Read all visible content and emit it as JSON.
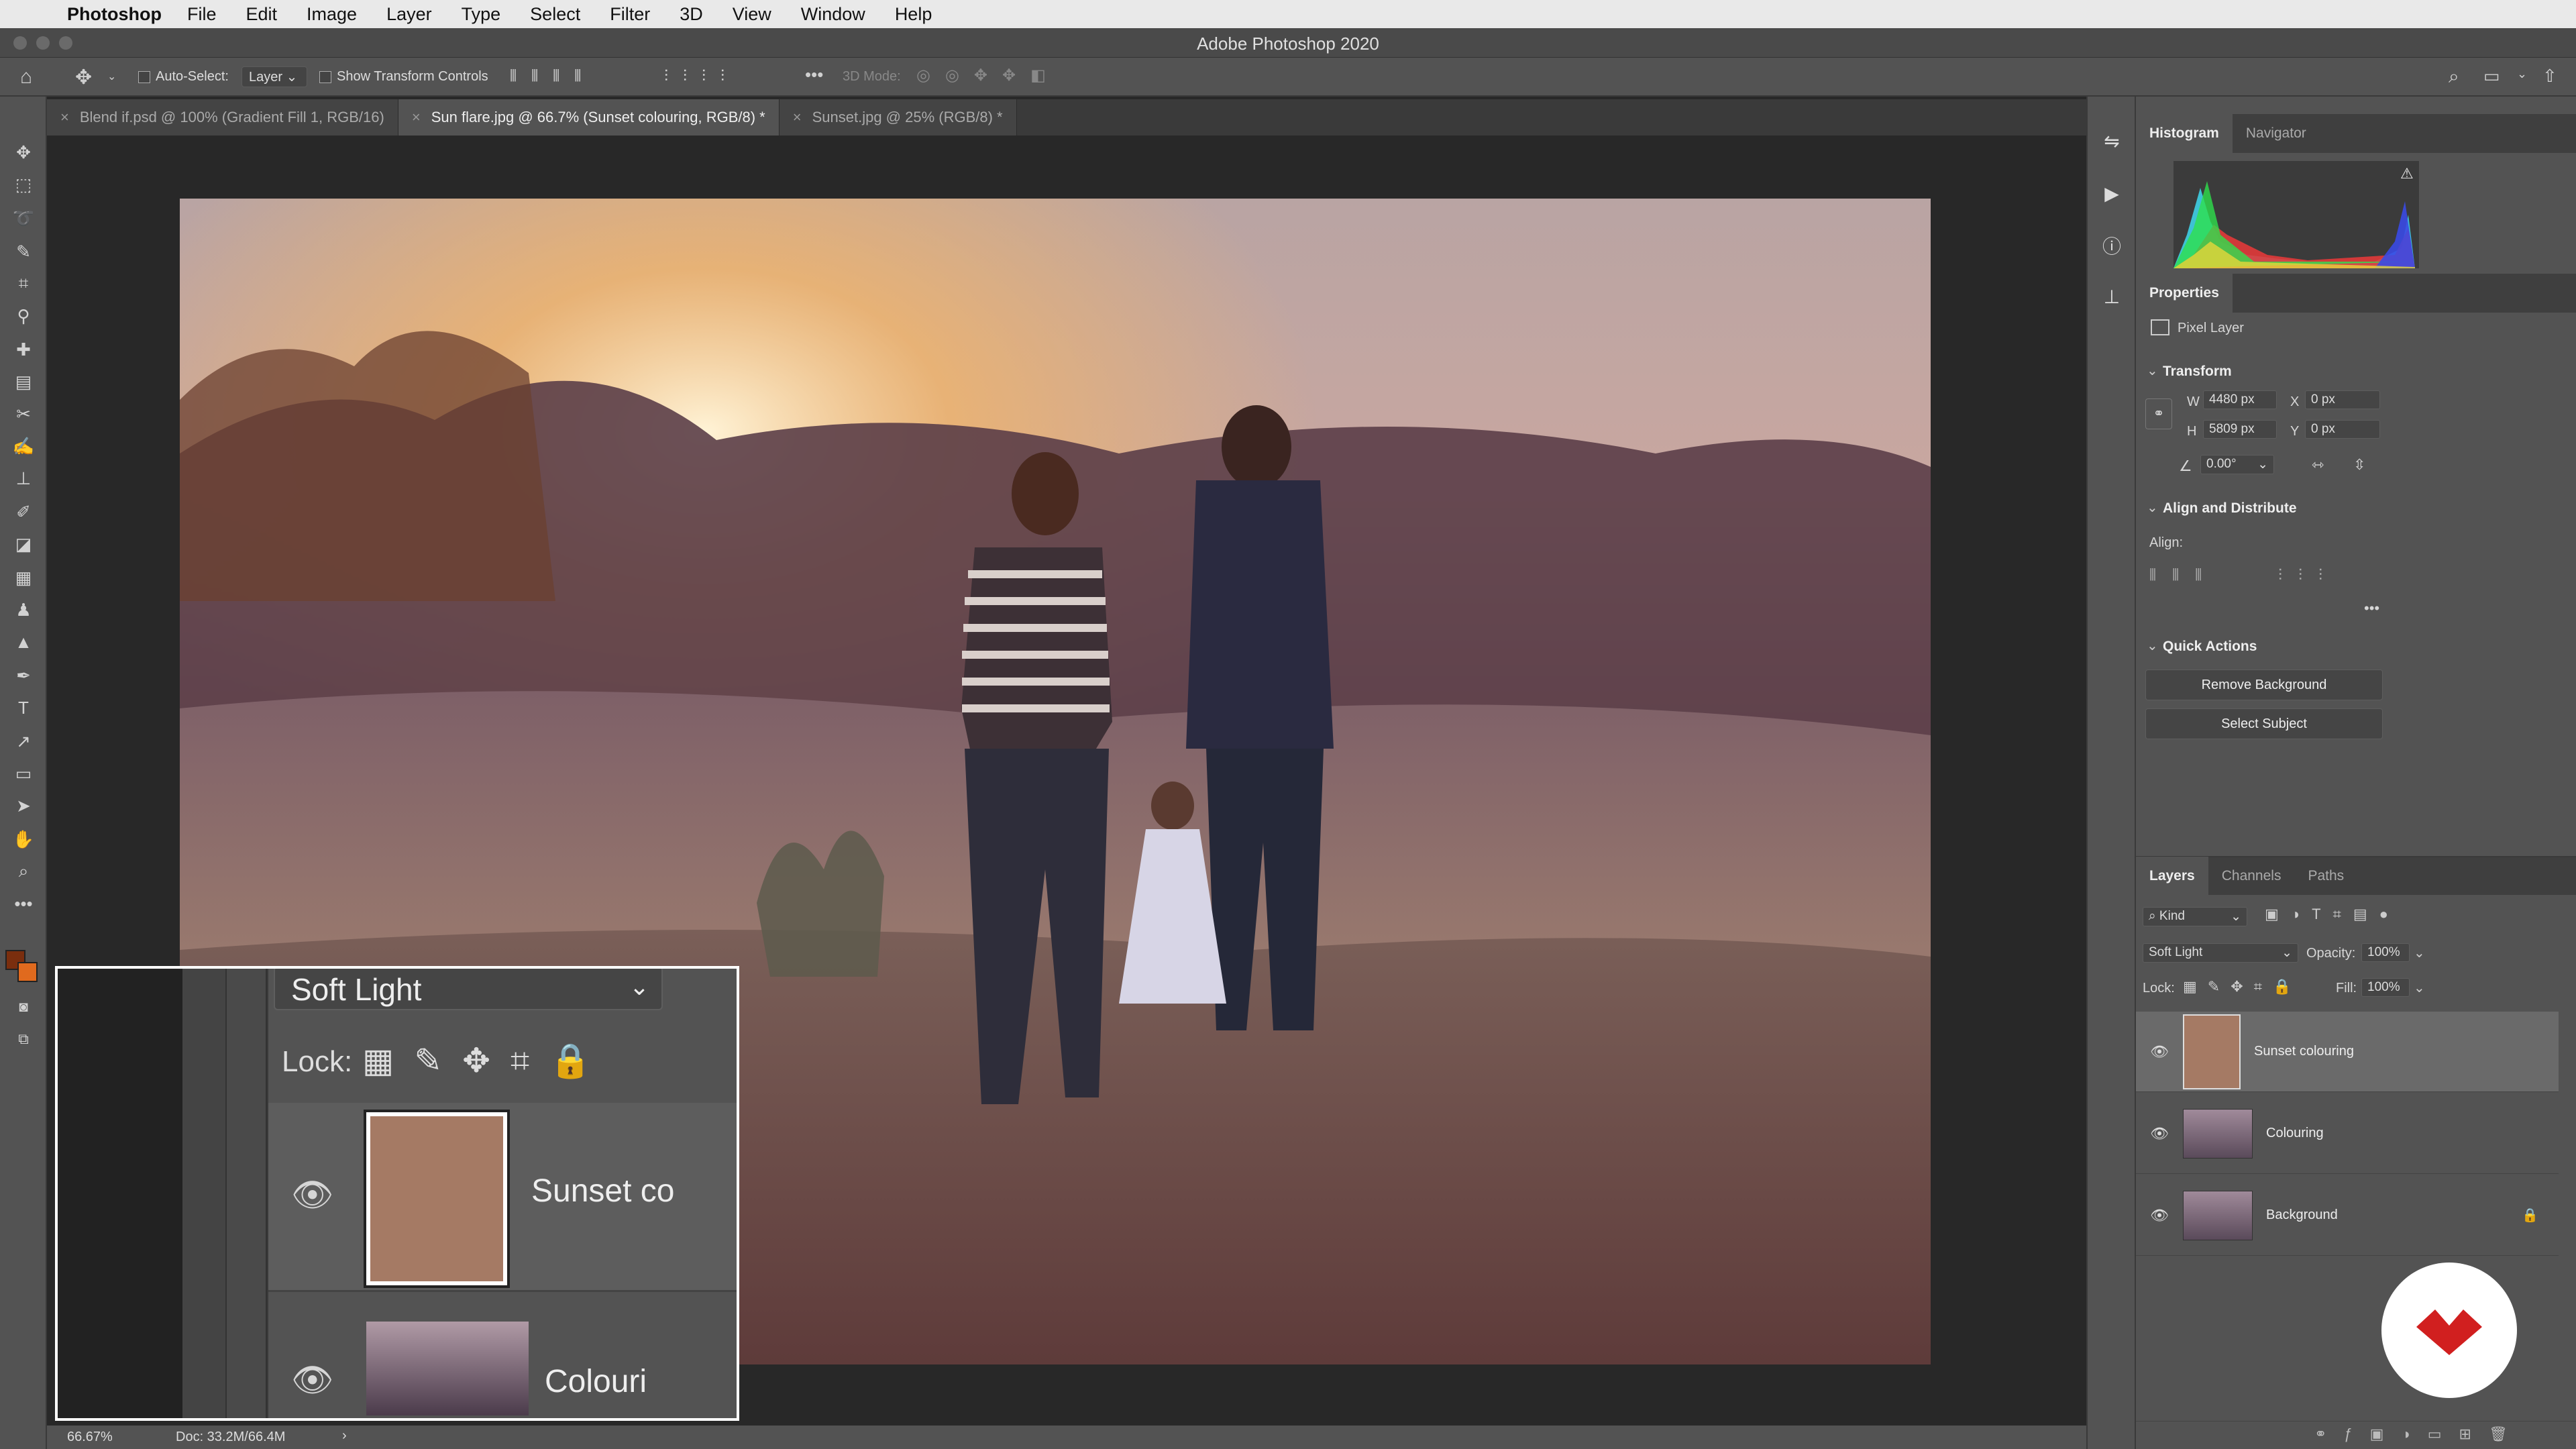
{
  "menubar": {
    "app_name": "Photoshop",
    "items": [
      "File",
      "Edit",
      "Image",
      "Layer",
      "Type",
      "Select",
      "Filter",
      "3D",
      "View",
      "Window",
      "Help"
    ]
  },
  "window": {
    "title": "Adobe Photoshop 2020"
  },
  "options_bar": {
    "auto_select_label": "Auto-Select:",
    "auto_select_value": "Layer",
    "show_transform_label": "Show Transform Controls",
    "mode_3d_label": "3D Mode:"
  },
  "tabs": [
    {
      "label": "Blend if.psd @ 100% (Gradient Fill 1, RGB/16)",
      "active": false
    },
    {
      "label": "Sun flare.jpg @ 66.7% (Sunset colouring, RGB/8) *",
      "active": true
    },
    {
      "label": "Sunset.jpg @ 25% (RGB/8) *",
      "active": false
    }
  ],
  "status": {
    "zoom": "66.67%",
    "doc": "Doc: 33.2M/66.4M",
    "arrow": "›"
  },
  "colors": {
    "foreground": "#7a2e0e",
    "background": "#e06a1e",
    "layer_fill": "#a57a64",
    "logo_red": "#d11f1f"
  },
  "histogram": {
    "tabs": [
      "Histogram",
      "Navigator"
    ],
    "warning": "⚠"
  },
  "properties": {
    "title": "Properties",
    "kind": "Pixel Layer",
    "transform_label": "Transform",
    "w_label": "W",
    "w_value": "4480 px",
    "h_label": "H",
    "h_value": "5809 px",
    "x_label": "X",
    "x_value": "0 px",
    "y_label": "Y",
    "y_value": "0 px",
    "angle_value": "0.00°",
    "align_label": "Align and Distribute",
    "align_sub": "Align:",
    "more": "•••",
    "quick_label": "Quick Actions",
    "remove_bg": "Remove Background",
    "select_subject": "Select Subject"
  },
  "layers_panel": {
    "tabs": [
      "Layers",
      "Channels",
      "Paths"
    ],
    "kind": "Kind",
    "blend_mode": "Soft Light",
    "opacity_label": "Opacity:",
    "opacity_value": "100%",
    "lock_label": "Lock:",
    "fill_label": "Fill:",
    "fill_value": "100%",
    "layers": [
      {
        "name": "Sunset colouring",
        "selected": true
      },
      {
        "name": "Colouring",
        "selected": false
      },
      {
        "name": "Background",
        "selected": false,
        "locked": true
      }
    ]
  },
  "zoom_overlay": {
    "blend_mode": "Soft Light",
    "lock_label": "Lock:",
    "layer1_name": "Sunset co",
    "layer2_name": "Colouri"
  }
}
